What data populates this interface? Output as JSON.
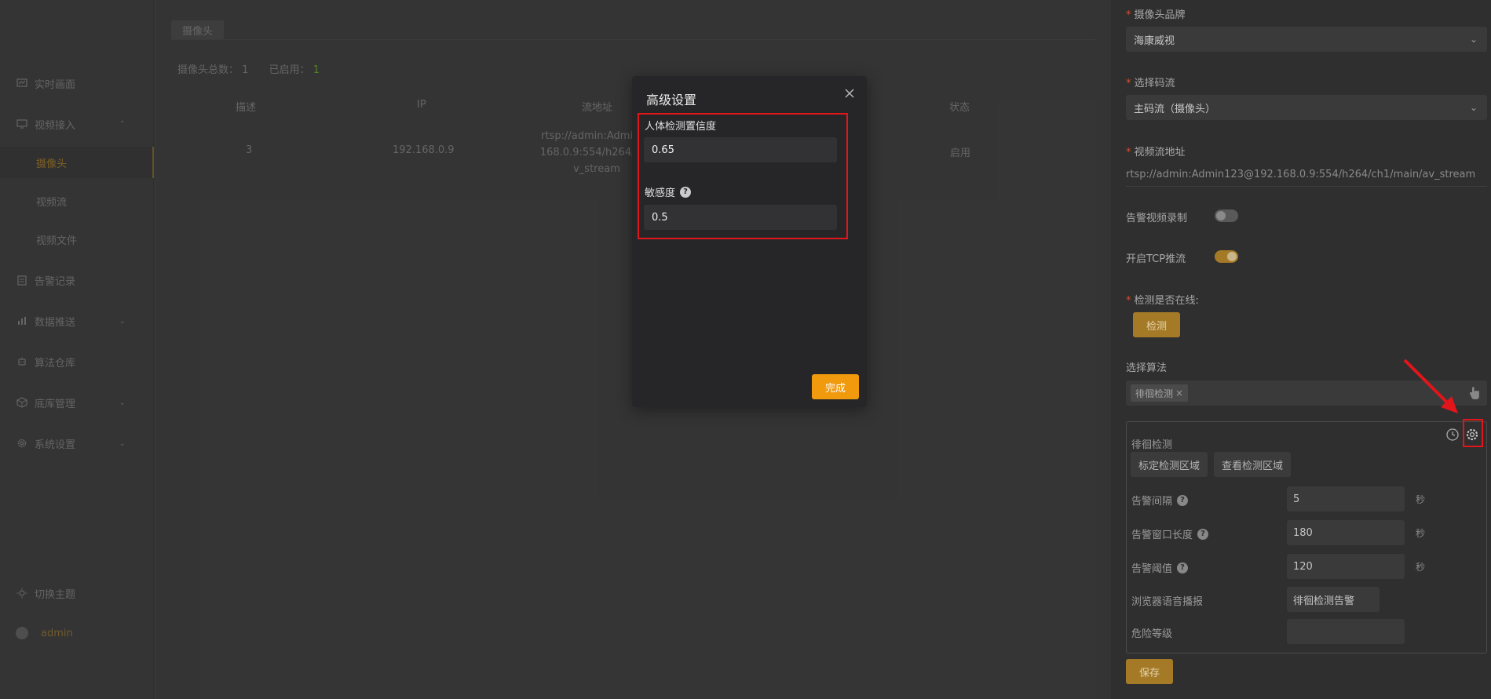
{
  "sidebar": {
    "items": [
      {
        "label": "实时画面",
        "icon": "monitor-chart-icon"
      },
      {
        "label": "视频接入",
        "icon": "video-monitor-icon",
        "arrow": "⌃"
      },
      {
        "label": "摄像头"
      },
      {
        "label": "视频流"
      },
      {
        "label": "视频文件"
      },
      {
        "label": "告警记录",
        "icon": "clipboard-icon"
      },
      {
        "label": "数据推送",
        "icon": "bar-chart-icon",
        "arrow": "⌄"
      },
      {
        "label": "算法仓库",
        "icon": "robot-icon"
      },
      {
        "label": "底库管理",
        "icon": "cube-icon",
        "arrow": "⌄"
      },
      {
        "label": "系统设置",
        "icon": "gear-icon",
        "arrow": "⌄"
      }
    ],
    "theme_label": "切换主题",
    "user_name": "admin"
  },
  "main": {
    "tab": "摄像头",
    "stats": {
      "total_label": "摄像头总数：",
      "total": "1",
      "enabled_label": "已启用：",
      "enabled": "1"
    },
    "table": {
      "headers": [
        "描述",
        "IP",
        "流地址",
        "状态"
      ],
      "rows": [
        {
          "desc": "3",
          "ip": "192.168.0.9",
          "stream": "rtsp://admin:Admin123@192.168.0.9:554/h264/ch1/main/av_stream",
          "stream_display": [
            "rtsp://admin:Admin12",
            "168.0.9:554/h264/ch1",
            "v_stream"
          ],
          "status": "启用"
        }
      ]
    }
  },
  "panel": {
    "brand_label": "摄像头品牌",
    "brand_value": "海康威视",
    "stream_type_label": "选择码流",
    "stream_type_value": "主码流（摄像头）",
    "url_label": "视频流地址",
    "url_value": "rtsp://admin:Admin123@192.168.0.9:554/h264/ch1/main/av_stream",
    "record_label": "告警视频录制",
    "record_on": false,
    "tcp_label": "开启TCP推流",
    "tcp_on": true,
    "online_label": "检测是否在线:",
    "online_button": "检测",
    "algorithm_label": "选择算法",
    "algorithm_tag": "徘徊检测",
    "algorithm": {
      "name": "徘徊检测",
      "mark_button": "标定检测区域",
      "view_button": "查看检测区域",
      "fields": [
        {
          "label": "告警间隔",
          "help": true,
          "value": "5",
          "unit": "秒"
        },
        {
          "label": "告警窗口长度",
          "help": true,
          "value": "180",
          "unit": "秒"
        },
        {
          "label": "告警阈值",
          "help": true,
          "value": "120",
          "unit": "秒"
        },
        {
          "label": "浏览器语音播报",
          "help": false,
          "value": "徘徊检测告警",
          "unit": ""
        },
        {
          "label": "危险等级",
          "help": false,
          "value": "",
          "unit": ""
        }
      ]
    },
    "save_button": "保存"
  },
  "modal": {
    "title": "高级设置",
    "field1_label": "人体检测置信度",
    "field1_value": "0.65",
    "field2_label": "敏感度",
    "field2_value": "0.5",
    "done_button": "完成"
  },
  "colors": {
    "accent": "#a57a27",
    "done": "#f19a0d",
    "highlight": "#e0161b"
  }
}
